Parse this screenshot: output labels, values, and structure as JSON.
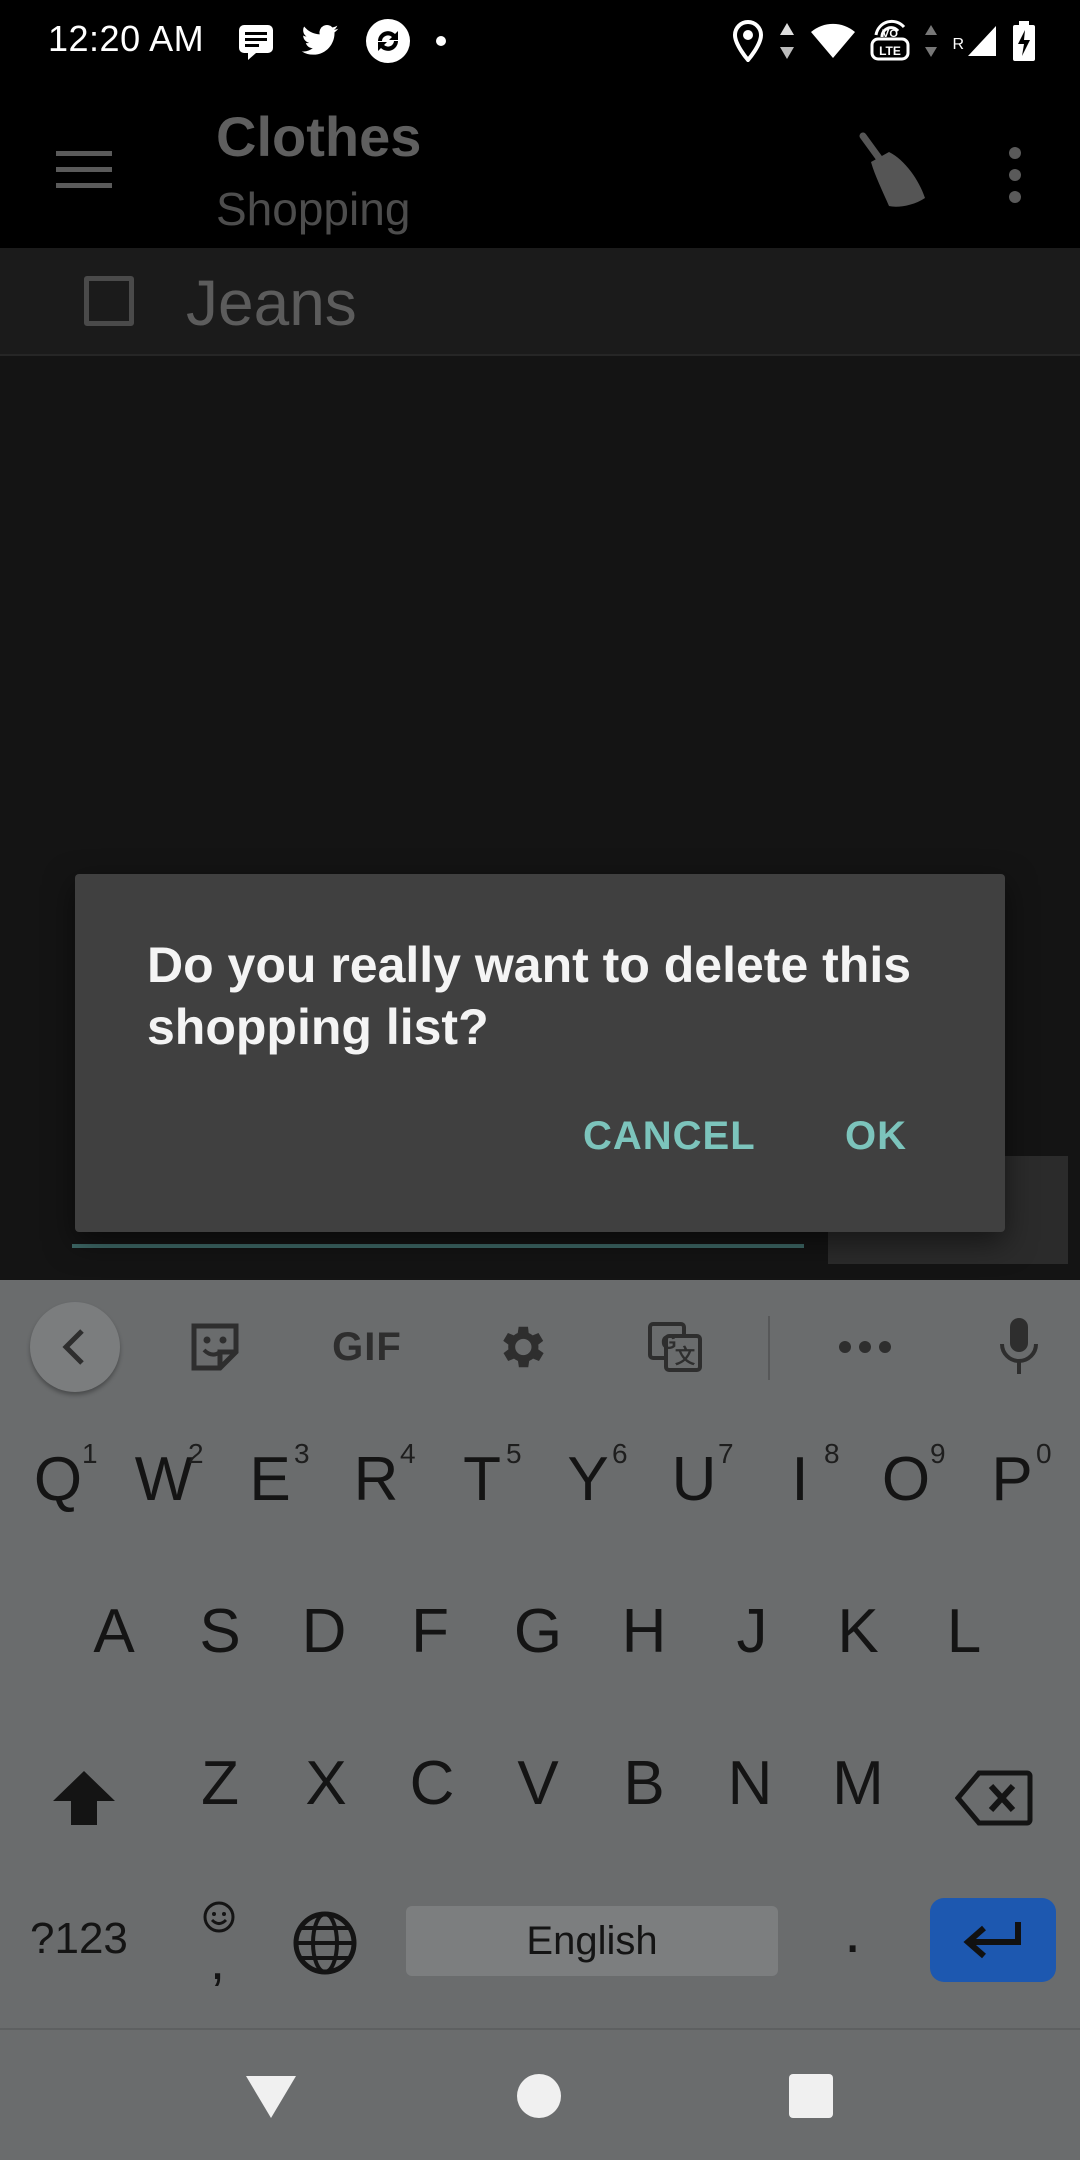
{
  "status_bar": {
    "time": "12:20 AM",
    "notification_icons": [
      "message-icon",
      "twitter-icon",
      "sync-app-icon",
      "dot-icon"
    ],
    "system_icons": [
      "location-icon",
      "data-arrows-icon",
      "wifi-icon",
      "volte-icon",
      "signal-icon",
      "battery-icon"
    ],
    "volte_label": "VO LTE",
    "roaming_label": "R"
  },
  "app_bar": {
    "title": "Clothes",
    "subtitle": "Shopping",
    "icons": [
      "menu-icon",
      "broom-icon",
      "more-vert-icon"
    ]
  },
  "list": {
    "items": [
      {
        "label": "Jeans",
        "checked": false
      }
    ]
  },
  "dialog": {
    "message": "Do you really want to delete this shopping list?",
    "cancel_label": "CANCEL",
    "ok_label": "OK",
    "accent_color": "#7cc4bc"
  },
  "keyboard": {
    "toolbar": {
      "items": [
        "back-icon",
        "sticker-icon",
        "gif-icon",
        "settings-icon",
        "translate-icon",
        "more-icon",
        "mic-icon"
      ],
      "gif_label": "GIF"
    },
    "row1": [
      {
        "key": "Q",
        "hint": "1"
      },
      {
        "key": "W",
        "hint": "2"
      },
      {
        "key": "E",
        "hint": "3"
      },
      {
        "key": "R",
        "hint": "4"
      },
      {
        "key": "T",
        "hint": "5"
      },
      {
        "key": "Y",
        "hint": "6"
      },
      {
        "key": "U",
        "hint": "7"
      },
      {
        "key": "I",
        "hint": "8"
      },
      {
        "key": "O",
        "hint": "9"
      },
      {
        "key": "P",
        "hint": "0"
      }
    ],
    "row2": [
      "A",
      "S",
      "D",
      "F",
      "G",
      "H",
      "J",
      "K",
      "L"
    ],
    "row3": [
      "Z",
      "X",
      "C",
      "V",
      "B",
      "N",
      "M"
    ],
    "symbols_label": "?123",
    "comma_label": ",",
    "space_label": "English",
    "period_label": ".",
    "enter_color": "#1d58b0"
  },
  "nav_bar": {
    "buttons": [
      "back-triangle-icon",
      "home-circle-icon",
      "recents-square-icon"
    ]
  }
}
